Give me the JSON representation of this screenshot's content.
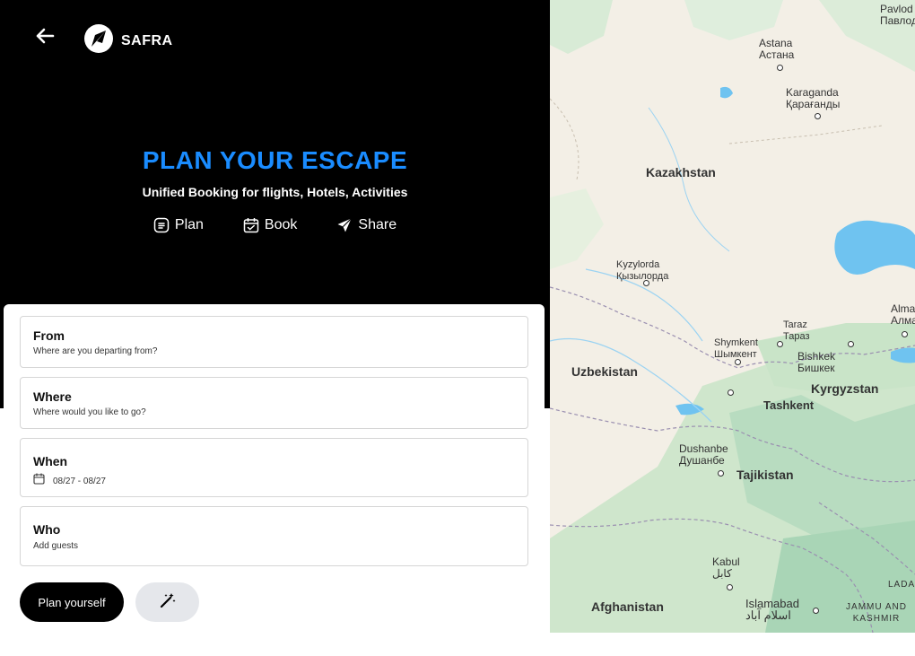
{
  "header": {
    "brand": "SAFRA"
  },
  "hero": {
    "headline": "PLAN YOUR ESCAPE",
    "subline": "Unified Booking for flights, Hotels, Activities",
    "actions": [
      {
        "label": "Plan",
        "icon": "plan-icon"
      },
      {
        "label": "Book",
        "icon": "calendar-check-icon"
      },
      {
        "label": "Share",
        "icon": "send-icon"
      }
    ]
  },
  "form": {
    "from": {
      "label": "From",
      "placeholder": "Where are you departing from?"
    },
    "where": {
      "label": "Where",
      "placeholder": "Where would you like to go?"
    },
    "when": {
      "label": "When",
      "value": "08/27 - 08/27"
    },
    "who": {
      "label": "Who",
      "placeholder": "Add guests"
    },
    "plan_button": "Plan yourself",
    "magic_button_icon": "magic-wand-icon"
  },
  "map": {
    "countries": [
      "Kazakhstan",
      "Uzbekistan",
      "Kyrgyzstan",
      "Tajikistan",
      "Afghanistan"
    ],
    "cities": [
      {
        "name": "Astana",
        "alt": "Астана"
      },
      {
        "name": "Karaganda",
        "alt": "Қарағанды"
      },
      {
        "name": "Kyzylorda",
        "alt": "Қызылорда"
      },
      {
        "name": "Taraz",
        "alt": "Тараз"
      },
      {
        "name": "Shymkent",
        "alt": "Шымкент"
      },
      {
        "name": "Bishkek",
        "alt": "Бишкек"
      },
      {
        "name": "Tashkent",
        "alt": ""
      },
      {
        "name": "Dushanbe",
        "alt": "Душанбе"
      },
      {
        "name": "Kabul",
        "alt": "کابل"
      },
      {
        "name": "Islamabad",
        "alt": "اسلام آباد"
      },
      {
        "name": "Almat",
        "alt": "Алмат"
      },
      {
        "name": "Pavlod",
        "alt": "Павлод"
      }
    ],
    "region": "JAMMU AND KASHMIR",
    "region_partial": "LADA"
  },
  "colors": {
    "accent": "#1a8cff",
    "hero_bg": "#000000",
    "map_land": "#f3efe6",
    "map_water": "#6fc3f0"
  }
}
